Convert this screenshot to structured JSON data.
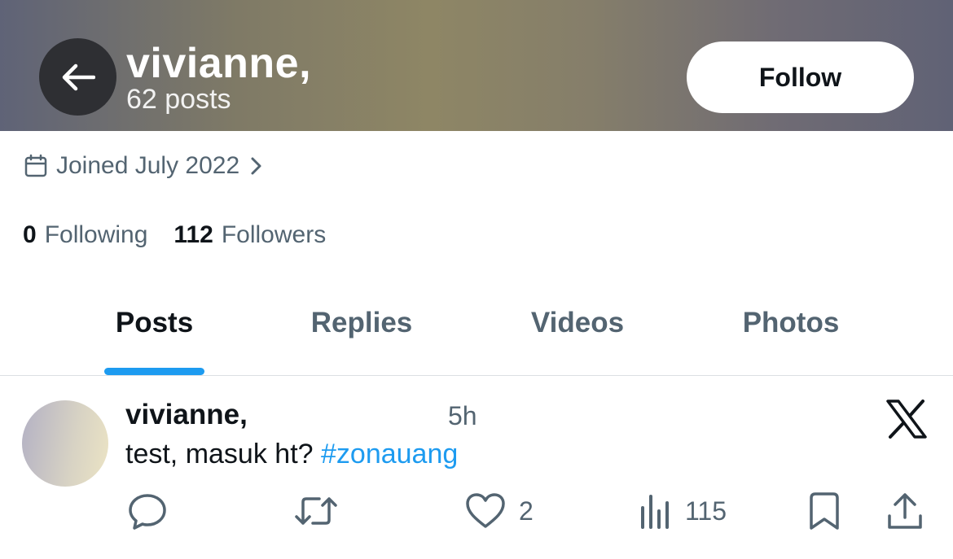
{
  "header": {
    "name": "vivianne,",
    "posts_count": "62 posts",
    "follow_label": "Follow"
  },
  "profile": {
    "joined": "Joined July 2022",
    "following_count": "0",
    "following_label": "Following",
    "followers_count": "112",
    "followers_label": "Followers"
  },
  "tabs": [
    {
      "label": "Posts",
      "active": true
    },
    {
      "label": "Replies",
      "active": false
    },
    {
      "label": "Videos",
      "active": false
    },
    {
      "label": "Photos",
      "active": false
    }
  ],
  "post": {
    "author": "vivianne,",
    "time": "5h",
    "text": "test, masuk ht? ",
    "hashtag": "#zonauang",
    "likes": "2",
    "views": "115"
  },
  "icons": {
    "back": "arrow-left-icon",
    "calendar": "calendar-icon",
    "chevron": "chevron-right-icon",
    "brand": "x-logo-icon",
    "reply": "reply-icon",
    "repost": "repost-icon",
    "like": "heart-icon",
    "views": "views-icon",
    "bookmark": "bookmark-icon",
    "share": "share-icon"
  },
  "colors": {
    "accent": "#1d9bf0",
    "secondary_text": "#536471",
    "primary_text": "#0f1419"
  }
}
